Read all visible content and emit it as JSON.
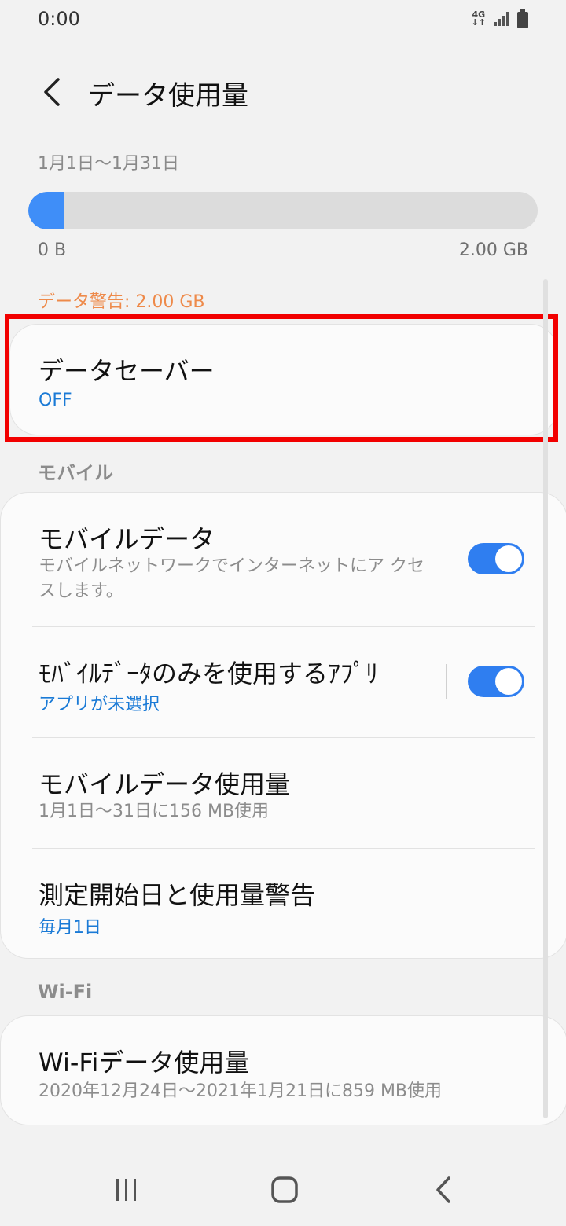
{
  "status_bar": {
    "time": "0:00",
    "network": "4G"
  },
  "header": {
    "title": "データ使用量"
  },
  "usage": {
    "period": "1月1日〜1月31日",
    "min_label": "0 B",
    "max_label": "2.00 GB",
    "fill_fraction": 0.07,
    "warning": "データ警告: 2.00 GB"
  },
  "data_saver": {
    "title": "データセーバー",
    "status": "OFF"
  },
  "mobile_section": {
    "label": "モバイル",
    "mobile_data": {
      "title": "モバイルデータ",
      "description": "モバイルネットワークでインターネットにア クセスします。",
      "enabled": true
    },
    "mobile_only_apps": {
      "title": "ﾓﾊﾞｲﾙﾃﾞｰﾀのみを使用するｱﾌﾟﾘ",
      "status": "アプリが未選択",
      "enabled": true
    },
    "mobile_data_usage": {
      "title": "モバイルデータ使用量",
      "subtitle": "1月1日〜31日に156 MB使用"
    },
    "billing_cycle": {
      "title": "測定開始日と使用量警告",
      "value": "毎月1日"
    }
  },
  "wifi_section": {
    "label": "Wi-Fi",
    "wifi_usage": {
      "title": "Wi-Fiデータ使用量",
      "subtitle": "2020年12月24日〜2021年1月21日に859 MB使用"
    }
  },
  "colors": {
    "accent": "#2f7ef0",
    "link": "#1a7ad6",
    "warning": "#ee8a4a",
    "highlight": "#f20000"
  },
  "nav_bar": {
    "icons": [
      "recent-apps-icon",
      "home-icon",
      "back-icon"
    ]
  }
}
